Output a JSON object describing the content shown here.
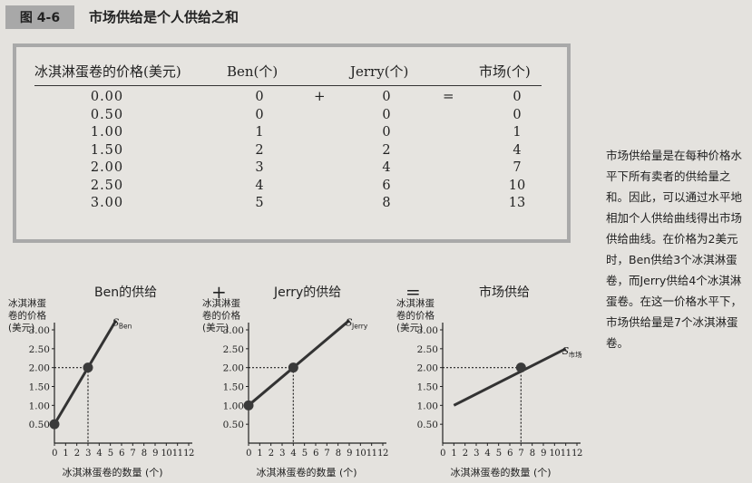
{
  "figure": {
    "label": "图 4-6",
    "title": "市场供给是个人供给之和"
  },
  "table": {
    "headers": [
      "冰淇淋蛋卷的价格(美元)",
      "Ben(个)",
      "Jerry(个)",
      "市场(个)"
    ],
    "plus": "+",
    "equals": "=",
    "rows": [
      {
        "price": "0.00",
        "ben": "0",
        "jerry": "0",
        "market": "0"
      },
      {
        "price": "0.50",
        "ben": "0",
        "jerry": "0",
        "market": "0"
      },
      {
        "price": "1.00",
        "ben": "1",
        "jerry": "0",
        "market": "1"
      },
      {
        "price": "1.50",
        "ben": "2",
        "jerry": "2",
        "market": "4"
      },
      {
        "price": "2.00",
        "ben": "3",
        "jerry": "4",
        "market": "7"
      },
      {
        "price": "2.50",
        "ben": "4",
        "jerry": "6",
        "market": "10"
      },
      {
        "price": "3.00",
        "ben": "5",
        "jerry": "8",
        "market": "13"
      }
    ]
  },
  "side_note": "市场供给量是在每种价格水平下所有卖者的供给量之和。因此，可以通过水平地相加个人供给曲线得出市场供给曲线。在价格为2美元时，Ben供给3个冰淇淋蛋卷，而Jerry供给4个冰淇淋蛋卷。在这一价格水平下，市场供给量是7个冰淇淋蛋卷。",
  "charts_row": {
    "plus": "+",
    "equals": "="
  },
  "chart_data": [
    {
      "type": "line",
      "title": "Ben的供给",
      "xlabel": "冰淇淋蛋卷的数量 (个)",
      "ylabel": [
        "冰淇淋蛋",
        "卷的价格",
        "(美元)"
      ],
      "curve_label": "S",
      "curve_label_sub": "Ben",
      "xlim": [
        0,
        12
      ],
      "ylim": [
        0,
        3.0
      ],
      "x_ticks": [
        "0",
        "1",
        "2",
        "3",
        "4",
        "5",
        "6",
        "7",
        "8",
        "9",
        "10",
        "11",
        "12"
      ],
      "y_ticks": [
        "0.50",
        "1.00",
        "1.50",
        "2.00",
        "2.50",
        "3.00"
      ],
      "y_tick_values": [
        0.5,
        1.0,
        1.5,
        2.0,
        2.5,
        3.0
      ],
      "series": [
        {
          "x": [
            0,
            5.5
          ],
          "y": [
            0.5,
            3.25
          ]
        }
      ],
      "points": [
        {
          "x": 0,
          "y": 0.5
        },
        {
          "x": 3,
          "y": 2.0
        }
      ],
      "highlight": {
        "x": 3,
        "y": 2.0
      }
    },
    {
      "type": "line",
      "title": "Jerry的供给",
      "xlabel": "冰淇淋蛋卷的数量 (个)",
      "ylabel": [
        "冰淇淋蛋",
        "卷的价格",
        "(美元)"
      ],
      "curve_label": "S",
      "curve_label_sub": "Jerry",
      "xlim": [
        0,
        12
      ],
      "ylim": [
        0,
        3.0
      ],
      "x_ticks": [
        "0",
        "1",
        "2",
        "3",
        "4",
        "5",
        "6",
        "7",
        "8",
        "9",
        "10",
        "11",
        "12"
      ],
      "y_ticks": [
        "0.50",
        "1.00",
        "1.50",
        "2.00",
        "2.50",
        "3.00"
      ],
      "y_tick_values": [
        0.5,
        1.0,
        1.5,
        2.0,
        2.5,
        3.0
      ],
      "series": [
        {
          "x": [
            0,
            9
          ],
          "y": [
            1.0,
            3.25
          ]
        }
      ],
      "points": [
        {
          "x": 0,
          "y": 1.0
        },
        {
          "x": 4,
          "y": 2.0
        }
      ],
      "highlight": {
        "x": 4,
        "y": 2.0
      }
    },
    {
      "type": "line",
      "title": "市场供给",
      "xlabel": "冰淇淋蛋卷的数量 (个)",
      "ylabel": [
        "冰淇淋蛋",
        "卷的价格",
        "(美元)"
      ],
      "curve_label": "S",
      "curve_label_sub": "市场",
      "xlim": [
        0,
        12
      ],
      "ylim": [
        0,
        3.0
      ],
      "x_ticks": [
        "0",
        "1",
        "2",
        "3",
        "4",
        "5",
        "6",
        "7",
        "8",
        "9",
        "10",
        "11",
        "12"
      ],
      "y_ticks": [
        "0.50",
        "1.00",
        "1.50",
        "2.00",
        "2.50",
        "3.00"
      ],
      "y_tick_values": [
        0.5,
        1.0,
        1.5,
        2.0,
        2.5,
        3.0
      ],
      "series": [
        {
          "x": [
            1,
            11
          ],
          "y": [
            1.0,
            2.5
          ]
        }
      ],
      "points": [
        {
          "x": 7,
          "y": 2.0
        }
      ],
      "highlight": {
        "x": 7,
        "y": 2.0
      }
    }
  ]
}
